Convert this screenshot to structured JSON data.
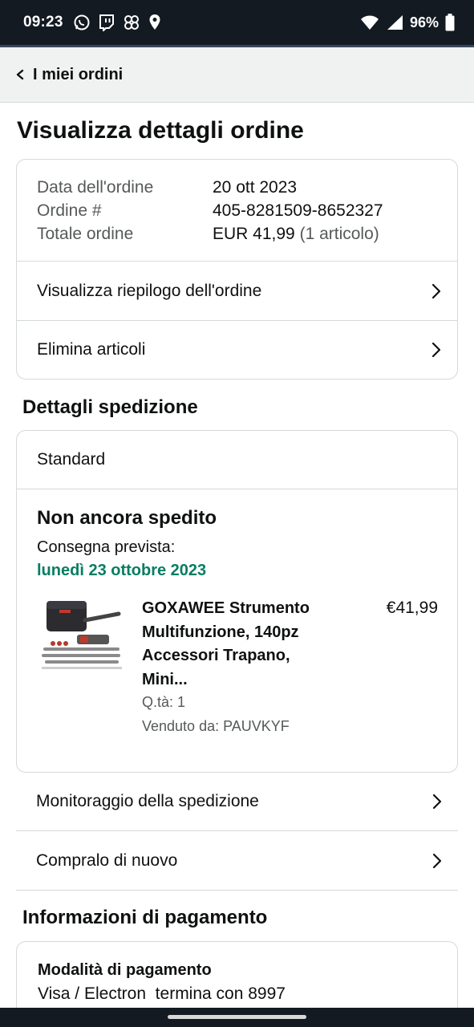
{
  "status_bar": {
    "time": "09:23",
    "battery": "96%",
    "left_icons": [
      "whatsapp-icon",
      "twitch-icon",
      "pinwheel-icon",
      "location-icon"
    ],
    "right_icons": [
      "wifi-icon",
      "signal-icon",
      "battery-icon"
    ]
  },
  "header": {
    "back_label": "I miei ordini"
  },
  "page": {
    "title": "Visualizza dettagli ordine"
  },
  "order": {
    "date_label": "Data dell'ordine",
    "date_value": "20 ott 2023",
    "number_label": "Ordine #",
    "number_value": "405-8281509-8652327",
    "total_label": "Totale ordine",
    "total_value": "EUR 41,99",
    "total_items": "(1 articolo)",
    "links": [
      "Visualizza riepilogo dell'ordine",
      "Elimina articoli"
    ]
  },
  "shipping": {
    "section_title": "Dettagli spedizione",
    "type": "Standard",
    "status": "Non ancora spedito",
    "delivery_label": "Consegna prevista:",
    "delivery_date": "lunedì 23 ottobre 2023",
    "product": {
      "title_lines": [
        "GOXAWEE Strumento",
        "Multifunzione, 140pz",
        "Accessori Trapano,",
        "Mini..."
      ],
      "price": "€41,99",
      "qty": "Q.tà: 1",
      "seller": "Venduto da: PAUVKYF"
    },
    "actions": [
      "Monitoraggio della spedizione",
      "Compralo di nuovo"
    ]
  },
  "payment": {
    "section_title": "Informazioni di pagamento",
    "method_label": "Modalità di pagamento",
    "method_value": "Visa / Electron  termina con 8997"
  },
  "colors": {
    "status_bar": "#131a22",
    "header_bg": "#f0f2f2",
    "delivery_green": "#067d62",
    "border": "#d5d9d9",
    "muted_text": "#565959"
  }
}
